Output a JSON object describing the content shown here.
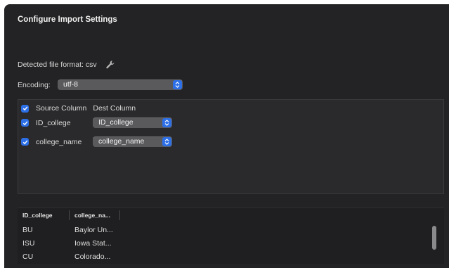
{
  "dialog": {
    "title": "Configure Import Settings"
  },
  "detected": {
    "label": "Detected file format: csv",
    "icon": "wrench-icon"
  },
  "encoding": {
    "label": "Encoding:",
    "value": "utf-8"
  },
  "mapping": {
    "header": {
      "source_label": "Source Column",
      "dest_label": "Dest Column",
      "checked": true
    },
    "rows": [
      {
        "source": "ID_college",
        "dest": "ID_college",
        "checked": true
      },
      {
        "source": "college_name",
        "dest": "college_name",
        "checked": true
      }
    ]
  },
  "preview": {
    "columns": [
      "ID_college",
      "college_na..."
    ],
    "rows": [
      [
        "BU",
        "Baylor Un..."
      ],
      [
        "ISU",
        "Iowa Stat..."
      ],
      [
        "CU",
        "Colorado..."
      ]
    ]
  },
  "colors": {
    "background": "#232325",
    "accent": "#2d6fe6",
    "popup": "#5a5a5d"
  }
}
